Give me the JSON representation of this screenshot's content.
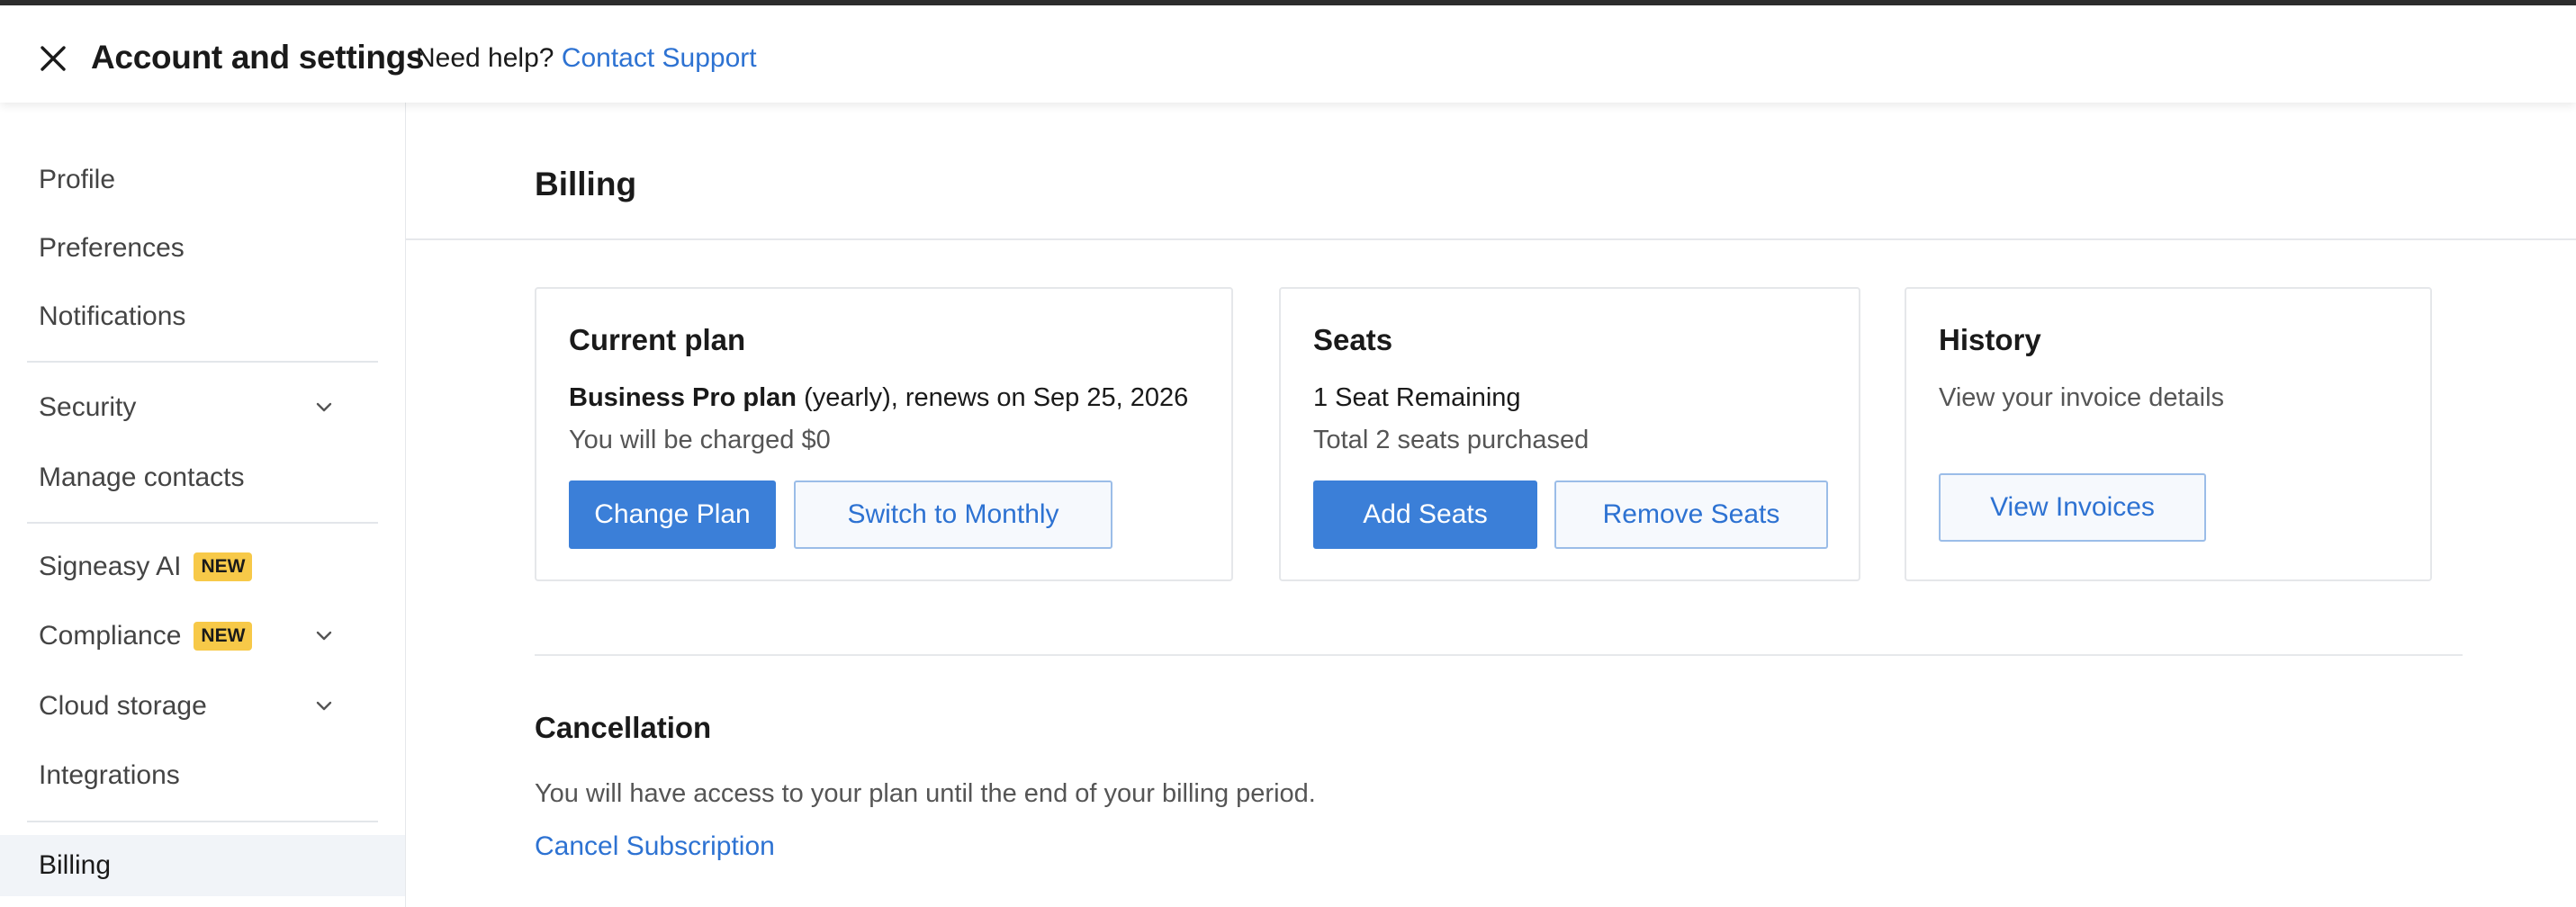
{
  "header": {
    "title": "Account and settings",
    "help_text": "Need help?",
    "support_link": "Contact Support"
  },
  "sidebar": {
    "items": [
      {
        "label": "Profile"
      },
      {
        "label": "Preferences"
      },
      {
        "label": "Notifications"
      },
      {
        "label": "Security",
        "expandable": true
      },
      {
        "label": "Manage contacts"
      },
      {
        "label": "Signeasy AI",
        "badge": "NEW"
      },
      {
        "label": "Compliance",
        "badge": "NEW",
        "expandable": true
      },
      {
        "label": "Cloud storage",
        "expandable": true
      },
      {
        "label": "Integrations"
      },
      {
        "label": "Billing",
        "active": true
      }
    ]
  },
  "main": {
    "title": "Billing",
    "current_plan": {
      "title": "Current plan",
      "plan_name": "Business Pro plan",
      "plan_detail": " (yearly), renews on Sep 25, 2026",
      "charge_text": "You will be charged $0",
      "change_label": "Change Plan",
      "switch_label": "Switch to Monthly"
    },
    "seats": {
      "title": "Seats",
      "remaining": "1 Seat Remaining",
      "total": "Total 2 seats purchased",
      "add_label": "Add Seats",
      "remove_label": "Remove Seats"
    },
    "history": {
      "title": "History",
      "description": "View your invoice details",
      "view_label": "View Invoices"
    },
    "cancellation": {
      "title": "Cancellation",
      "text": "You will have access to your plan until the end of your billing period.",
      "link": "Cancel Subscription"
    }
  },
  "colors": {
    "accent": "#3b7fd8",
    "link": "#2d72d2",
    "badge": "#f7c948",
    "active_bg": "#f1f4f8"
  },
  "icons": {
    "close": "close-icon",
    "chevron": "chevron-down-icon"
  }
}
